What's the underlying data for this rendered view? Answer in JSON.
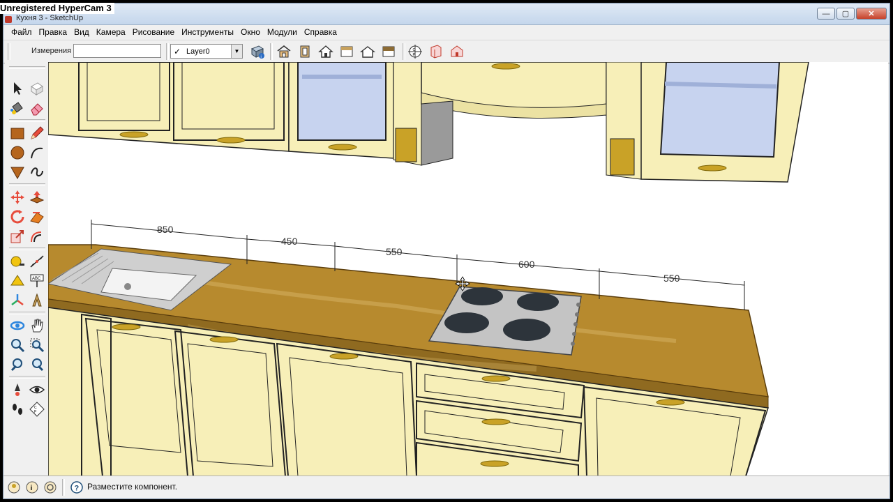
{
  "recording_watermark": "Unregistered HyperCam 3",
  "window": {
    "caption": "Кухня 3 - SketchUp",
    "buttons": {
      "minimize": "—",
      "maximize": "▢",
      "close": "✕"
    }
  },
  "menubar": {
    "items": [
      "Файл",
      "Правка",
      "Вид",
      "Камера",
      "Рисование",
      "Инструменты",
      "Окно",
      "Модули",
      "Справка"
    ]
  },
  "toolbar": {
    "measure_label": "Измерения",
    "measure_value": "",
    "layer_check": "✓",
    "layer_name": "Layer0",
    "layer_arrow": "▼",
    "view_icons": [
      "components-icon",
      "iso-view-icon",
      "front-view-icon",
      "home-view-icon",
      "top-view-icon",
      "right-view-icon",
      "back-view-icon",
      "section-icon",
      "position-camera-icon",
      "shadow-box-icon",
      "house-box-icon"
    ]
  },
  "left_toolbar": {
    "tools": [
      "select-tool",
      "component-tool",
      "paint-bucket-tool",
      "eraser-tool",
      "rectangle-tool",
      "line-tool",
      "circle-tool",
      "arc-tool",
      "polygon-tool",
      "freehand-tool",
      "move-tool",
      "push-pull-tool",
      "rotate-tool",
      "follow-me-tool",
      "scale-tool",
      "offset-tool",
      "tape-measure-tool",
      "dimension-tool",
      "protractor-tool",
      "text-tool",
      "axes-tool",
      "3d-text-tool",
      "orbit-tool",
      "pan-tool",
      "zoom-tool",
      "zoom-extents-tool",
      "previous-view-tool",
      "next-view-tool",
      "position-camera-tool",
      "look-around-tool",
      "walk-tool",
      "section-plane-tool"
    ]
  },
  "dimensions": [
    "850",
    "450",
    "550",
    "600",
    "550"
  ],
  "colors": {
    "cabinet": "#f7efb8",
    "countertop": "#b78a2e",
    "handle": "#c9a227",
    "dimension_line": "#222222"
  },
  "statusbar": {
    "message": "Разместите компонент.",
    "help_icon": "?"
  }
}
